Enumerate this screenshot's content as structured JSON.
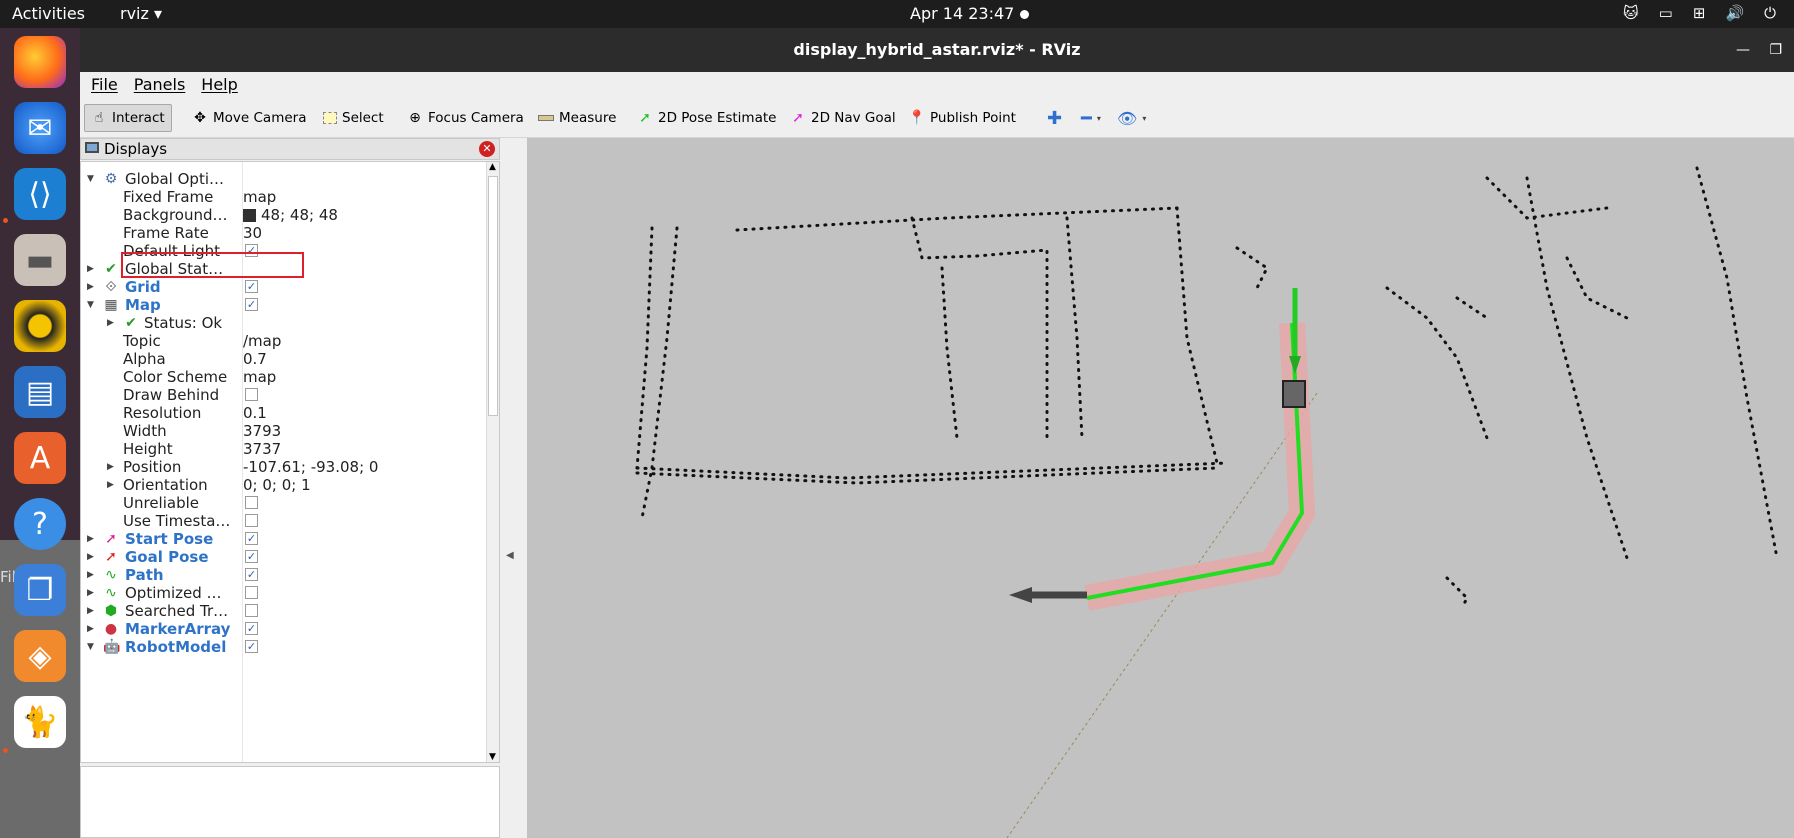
{
  "topbar": {
    "activities": "Activities",
    "app_name": "rviz",
    "clock": "Apr 14  23:47"
  },
  "dock": {
    "items": [
      "firefox-icon",
      "thunderbird-icon",
      "vscode-icon",
      "files-icon",
      "rhythmbox-icon",
      "libreoffice-writer-icon",
      "app-center-icon",
      "help-icon",
      "workspace-icon",
      "layers-icon",
      "cat-icon"
    ],
    "ghost_menu": "File   Edit"
  },
  "window": {
    "title": "display_hybrid_astar.rviz* - RViz"
  },
  "menubar": {
    "file": "File",
    "panels": "Panels",
    "help": "Help"
  },
  "toolbar": {
    "interact": "Interact",
    "move_camera": "Move Camera",
    "select": "Select",
    "focus_camera": "Focus Camera",
    "measure": "Measure",
    "pose_estimate": "2D Pose Estimate",
    "nav_goal": "2D Nav Goal",
    "publish_point": "Publish Point"
  },
  "displays": {
    "header": "Displays",
    "rows": [
      {
        "label": "Global Opti…",
        "value": ""
      },
      {
        "label": "Fixed Frame",
        "value": "map"
      },
      {
        "label": "Background…",
        "value": "48; 48; 48"
      },
      {
        "label": "Frame Rate",
        "value": "30"
      },
      {
        "label": "Default Light",
        "value": ""
      },
      {
        "label": "Global Stat…",
        "value": ""
      },
      {
        "label": "Grid",
        "value": ""
      },
      {
        "label": "Map",
        "value": ""
      },
      {
        "label": "Status: Ok",
        "value": ""
      },
      {
        "label": "Topic",
        "value": "/map"
      },
      {
        "label": "Alpha",
        "value": "0.7"
      },
      {
        "label": "Color Scheme",
        "value": "map"
      },
      {
        "label": "Draw Behind",
        "value": ""
      },
      {
        "label": "Resolution",
        "value": "0.1"
      },
      {
        "label": "Width",
        "value": "3793"
      },
      {
        "label": "Height",
        "value": "3737"
      },
      {
        "label": "Position",
        "value": "-107.61; -93.08; 0"
      },
      {
        "label": "Orientation",
        "value": "0; 0; 0; 1"
      },
      {
        "label": "Unreliable",
        "value": ""
      },
      {
        "label": "Use Timesta…",
        "value": ""
      },
      {
        "label": "Start Pose",
        "value": ""
      },
      {
        "label": "Goal Pose",
        "value": ""
      },
      {
        "label": "Path",
        "value": ""
      },
      {
        "label": "Optimized …",
        "value": ""
      },
      {
        "label": "Searched Tr…",
        "value": ""
      },
      {
        "label": "MarkerArray",
        "value": ""
      },
      {
        "label": "RobotModel",
        "value": ""
      }
    ]
  },
  "colors": {
    "highlight": "#dd1f2e",
    "background_swatch": "#303030",
    "path": "#22dd22",
    "path_band": "#e8a6a6"
  }
}
